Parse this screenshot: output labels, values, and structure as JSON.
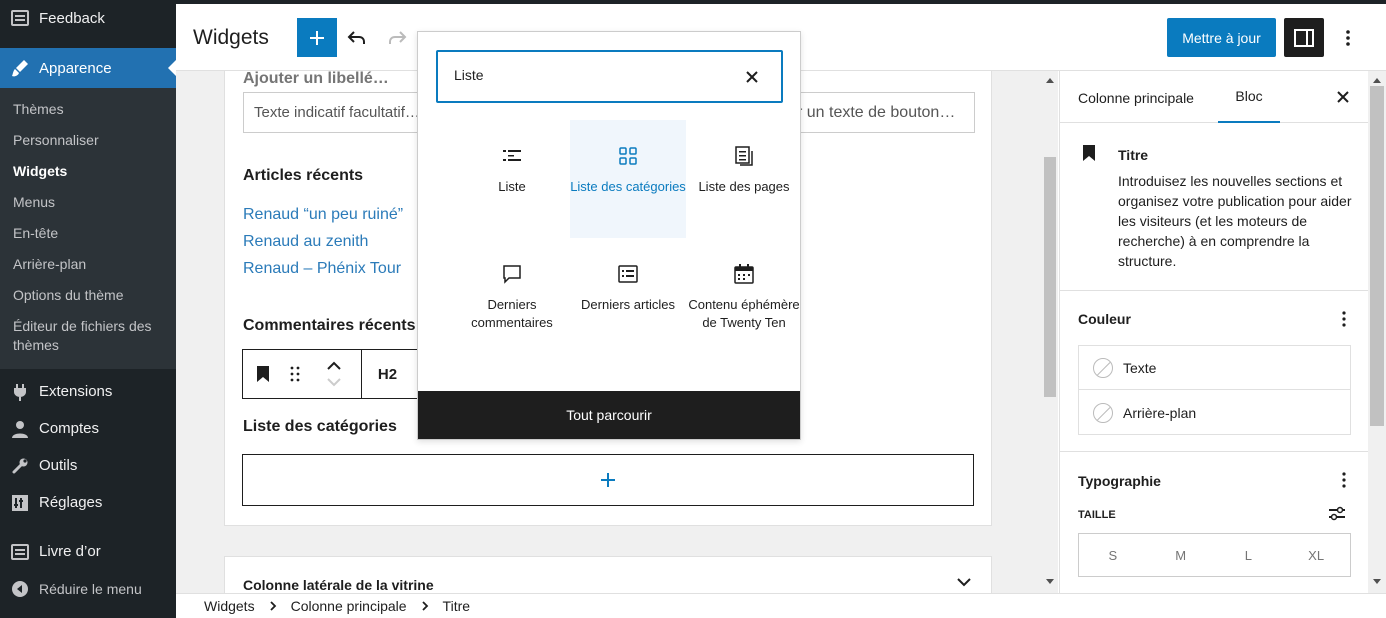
{
  "sidebar": {
    "top_item": "Feedback",
    "active_item": "Apparence",
    "submenu": [
      "Thèmes",
      "Personnaliser",
      "Widgets",
      "Menus",
      "En-tête",
      "Arrière-plan",
      "Options du thème",
      "Éditeur de fichiers des thèmes"
    ],
    "current_sub": "Widgets",
    "items": [
      "Extensions",
      "Comptes",
      "Outils",
      "Réglages",
      "Livre d’or",
      "Réduire le menu"
    ]
  },
  "header": {
    "title": "Widgets",
    "update_label": "Mettre à jour"
  },
  "canvas": {
    "field_label": "Ajouter un libellé…",
    "field_placeholder": "Texte indicatif facultatif…",
    "button_placeholder": "r un texte de bouton…",
    "recent_posts_title": "Articles récents",
    "recent_posts": [
      "Renaud “un peu ruiné”",
      "Renaud au zenith",
      "Renaud – Phénix Tour"
    ],
    "recent_comments_title": "Commentaires récents",
    "toolbar_heading_level": "H2",
    "categories_title": "Liste des catégories",
    "secondary_area_title": "Colonne latérale de la vitrine"
  },
  "inserter": {
    "search_value": "Liste",
    "blocks": [
      {
        "label": "Liste",
        "icon": "list-icon"
      },
      {
        "label": "Liste des catégories",
        "icon": "categories-icon",
        "selected": true
      },
      {
        "label": "Liste des pages",
        "icon": "pages-icon"
      },
      {
        "label": "Derniers commentaires",
        "icon": "comments-icon"
      },
      {
        "label": "Derniers articles",
        "icon": "posts-icon"
      },
      {
        "label": "Contenu éphémère de Twenty Ten",
        "icon": "calendar-icon"
      }
    ],
    "browse_all": "Tout parcourir"
  },
  "panel": {
    "tab_main": "Colonne principale",
    "tab_block": "Bloc",
    "block_name": "Titre",
    "block_description": "Introduisez les nouvelles sections et organisez votre publication pour aider les visiteurs (et les moteurs de recherche) à en comprendre la structure.",
    "color_title": "Couleur",
    "color_text": "Texte",
    "color_background": "Arrière-plan",
    "typography_title": "Typographie",
    "size_label": "TAILLE",
    "sizes": [
      "S",
      "M",
      "L",
      "XL"
    ]
  },
  "breadcrumb": [
    "Widgets",
    "Colonne principale",
    "Titre"
  ],
  "colors": {
    "accent": "#0a7bbf",
    "admin_bg": "#1d2327",
    "link": "#2b7bb9"
  }
}
